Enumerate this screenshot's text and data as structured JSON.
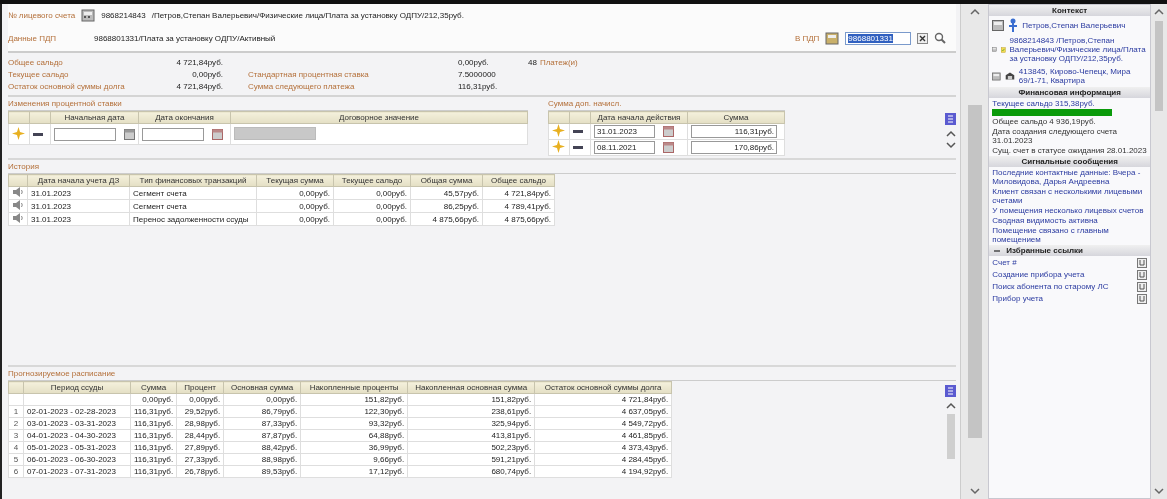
{
  "header": {
    "account_label": "№ лицевого счета",
    "account_number": "9868214843",
    "account_desc": "/Петров,Степан Валерьевич/Физические лица/Плата за установку ОДПУ/212,35руб.",
    "pdp_label": "Данные ПДП",
    "pdp_value": "9868801331/Плата за установку ОДПУ/Активный",
    "search_label": "В ПДП",
    "search_value": "9868801331",
    "search_value_selected": true
  },
  "summary": {
    "left": [
      {
        "label": "Общее сальдо",
        "value": "4 721,84руб."
      },
      {
        "label": "Текущее сальдо",
        "value": "0,00руб."
      },
      {
        "label": "Остаток основной суммы долга",
        "value": "4 721,84руб."
      }
    ],
    "right": [
      {
        "value": "0,00руб.",
        "count": "48",
        "link": "Платеж(и)"
      },
      {
        "label": "Стандартная процентная ставка",
        "value": "7.5000000"
      },
      {
        "label": "Сумма следующего платежа",
        "value": "116,31руб."
      }
    ]
  },
  "rate_changes": {
    "title": "Изменения процентной ставки",
    "columns": [
      "Начальная дата",
      "Дата окончания",
      "Договорное значение"
    ]
  },
  "extra_charges": {
    "title": "Сумма доп. начисл.",
    "columns": [
      "Дата начала действия",
      "Сумма"
    ],
    "rows": [
      [
        "31.01.2023",
        "116,31руб."
      ],
      [
        "08.11.2021",
        "170,86руб."
      ]
    ]
  },
  "history": {
    "title": "История",
    "columns": [
      "Дата начала учета ДЗ",
      "Тип финансовых транзакций",
      "Текущая сумма",
      "Текущее сальдо",
      "Общая сумма",
      "Общее сальдо"
    ],
    "rows": [
      [
        "31.01.2023",
        "Сегмент счета",
        "0,00руб.",
        "0,00руб.",
        "45,57руб.",
        "4 721,84руб."
      ],
      [
        "31.01.2023",
        "Сегмент счета",
        "0,00руб.",
        "0,00руб.",
        "86,25руб.",
        "4 789,41руб."
      ],
      [
        "31.01.2023",
        "Перенос задолженности ссуды",
        "0,00руб.",
        "0,00руб.",
        "4 875,66руб.",
        "4 875,66руб."
      ]
    ]
  },
  "schedule": {
    "title": "Прогнозируемое расписание",
    "columns": [
      "Период ссуды",
      "Сумма",
      "Процент",
      "Основная сумма",
      "Накопленные проценты",
      "Накопленная основная сумма",
      "Остаток основной суммы долга"
    ],
    "rows": [
      {
        "cells": [
          "",
          "0,00руб.",
          "0,00руб.",
          "0,00руб.",
          "151,82руб.",
          "151,82руб.",
          "4 721,84руб."
        ]
      },
      {
        "number": "1",
        "cells": [
          "02-01-2023 - 02-28-2023",
          "116,31руб.",
          "29,52руб.",
          "86,79руб.",
          "122,30руб.",
          "238,61руб.",
          "4 637,05руб."
        ]
      },
      {
        "number": "2",
        "cells": [
          "03-01-2023 - 03-31-2023",
          "116,31руб.",
          "28,98руб.",
          "87,33руб.",
          "93,32руб.",
          "325,94руб.",
          "4 549,72руб."
        ]
      },
      {
        "number": "3",
        "cells": [
          "04-01-2023 - 04-30-2023",
          "116,31руб.",
          "28,44руб.",
          "87,87руб.",
          "64,88руб.",
          "413,81руб.",
          "4 461,85руб."
        ]
      },
      {
        "number": "4",
        "cells": [
          "05-01-2023 - 05-31-2023",
          "116,31руб.",
          "27,89руб.",
          "88,42руб.",
          "36,99руб.",
          "502,23руб.",
          "4 373,43руб."
        ]
      },
      {
        "number": "5",
        "cells": [
          "06-01-2023 - 06-30-2023",
          "116,31руб.",
          "27,33руб.",
          "88,98руб.",
          "9,66руб.",
          "591,21руб.",
          "4 284,45руб."
        ]
      },
      {
        "number": "6",
        "cells": [
          "07-01-2023 - 07-31-2023",
          "116,31руб.",
          "26,78руб.",
          "89,53руб.",
          "17,12руб.",
          "680,74руб.",
          "4 194,92руб."
        ]
      }
    ]
  },
  "sidebar": {
    "context": {
      "title": "Контекст",
      "items": [
        {
          "kind": "person",
          "text": "Петров,Степан Валерьевич"
        },
        {
          "kind": "account",
          "text": "9868214843 /Петров,Степан Валерьевич/Физические лица/Плата за установку ОДПУ/212,35руб."
        },
        {
          "kind": "address",
          "text": "413845, Кирово-Чепецк, Мира 69/1-71, Квартира"
        }
      ]
    },
    "finance": {
      "title": "Финансовая информация",
      "balance": "Текущее сальдо 315,38руб.",
      "level": 1,
      "lines": [
        "Общее сальдо 4 936,19руб.",
        "Дата создания следующего счета 31.01.2023",
        "Сущ. счет в статусе ожидания 28.01.2023"
      ]
    },
    "signals": {
      "title": "Сигнальные сообщения",
      "items": [
        "Последние контактные данные: Вчера - Миловидова, Дарья Андреевна",
        "Клиент связан с несколькими лицевыми счетами",
        "У помещения несколько лицевых счетов",
        "Сводная видимость активна",
        "Помещение связано с главным помещением"
      ]
    },
    "favorites": {
      "title": "Избранные ссылки",
      "expanded": true,
      "items": [
        "Счет #",
        "Создание прибора учета",
        "Поиск абонента по старому ЛС",
        "Прибор учета"
      ]
    }
  }
}
